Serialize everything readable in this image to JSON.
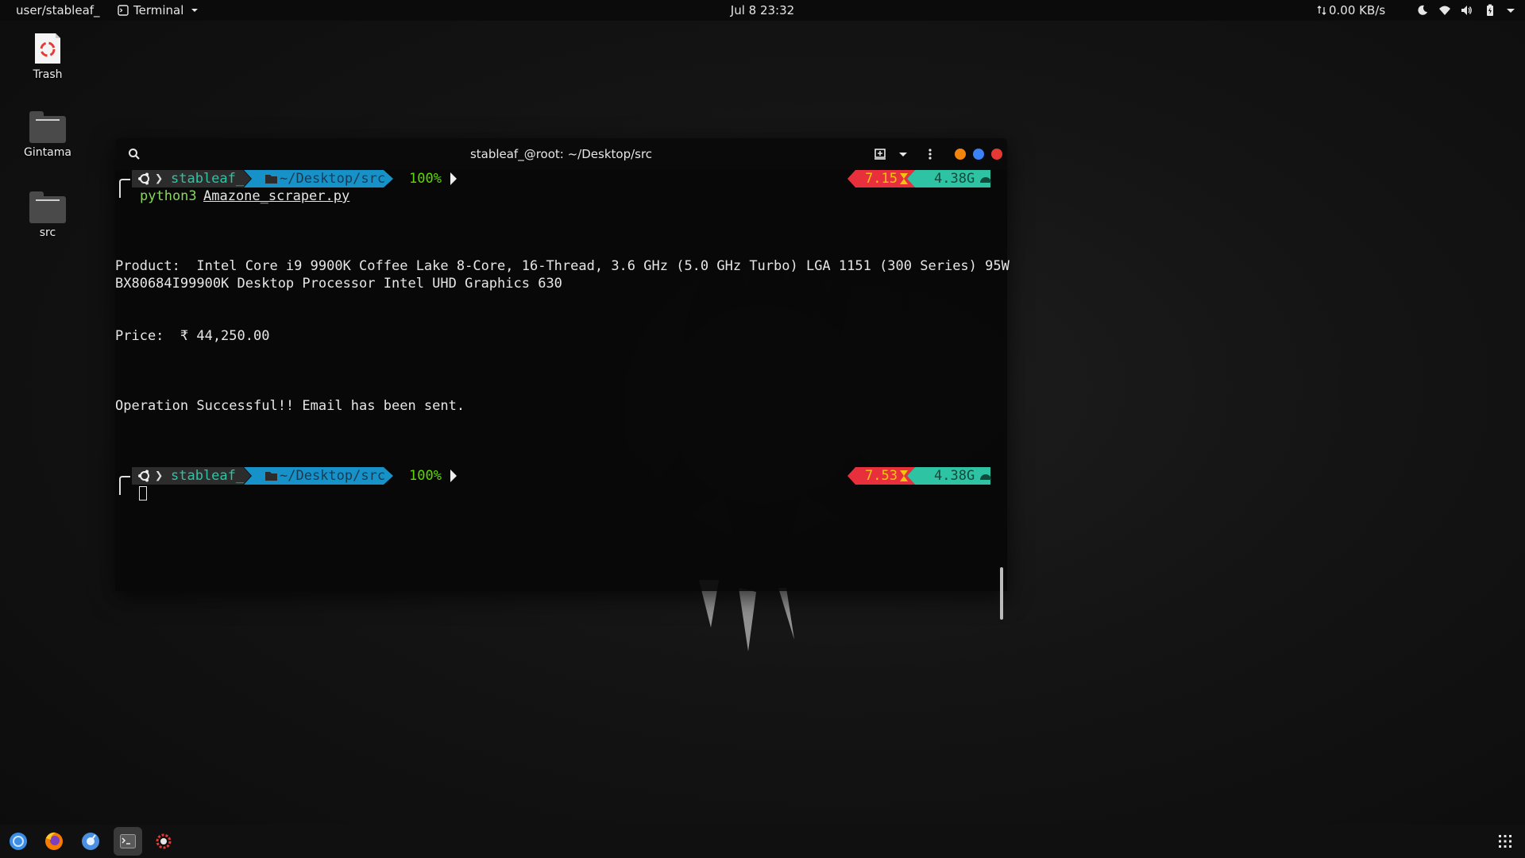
{
  "topbar": {
    "activities": "user/stableaf_",
    "app_menu": "Terminal",
    "clock": "Jul 8  23:32",
    "net_speed": "0.00 KB/s",
    "tray_icons": [
      "night-light-icon",
      "wifi-icon",
      "volume-icon",
      "battery-icon",
      "power-menu-icon"
    ]
  },
  "desktop": {
    "icons": [
      {
        "label": "Trash",
        "icon": "trash-icon"
      },
      {
        "label": "Gintama",
        "icon": "folder-icon"
      },
      {
        "label": "src",
        "icon": "folder-icon"
      }
    ]
  },
  "terminal": {
    "title": "stableaf_@root: ~/Desktop/src",
    "header_icons": [
      "search-icon",
      "new-tab-icon",
      "dropdown-icon",
      "menu-icon"
    ],
    "window_buttons": {
      "minimize": "#f2850d",
      "maximize": "#3b82f6",
      "close": "#e53935"
    },
    "prompts": [
      {
        "user": "stableaf_",
        "path": "~/Desktop/src",
        "battery": "100%",
        "load": "7.15",
        "ram": "4.38G",
        "command": "python3",
        "arg": "Amazone_scraper.py"
      },
      {
        "user": "stableaf_",
        "path": "~/Desktop/src",
        "battery": "100%",
        "load": "7.53",
        "ram": "4.38G",
        "command": "",
        "arg": ""
      }
    ],
    "output": {
      "product_line1": "Product:  Intel Core i9 9900K Coffee Lake 8-Core, 16-Thread, 3.6 GHz (5.0 GHz Turbo) LGA 1151 (300 Series) 95W",
      "product_line2": "BX80684I99900K Desktop Processor Intel UHD Graphics 630",
      "price": "Price:  ₹ 44,250.00",
      "status": "Operation Successful!! Email has been sent."
    },
    "colors": {
      "user_segment": "#2c2c2c",
      "path_segment": "#1692c9",
      "battery_text": "#5fd700",
      "load_segment": "#e8303c",
      "ram_segment": "#2ec4a3",
      "command_text": "#87d75f"
    }
  },
  "dock": {
    "items": [
      "ubuntu-icon",
      "firefox-icon",
      "music-player-icon",
      "terminal-icon",
      "settings-gear-icon"
    ],
    "show_apps_icon": "app-grid-icon"
  }
}
